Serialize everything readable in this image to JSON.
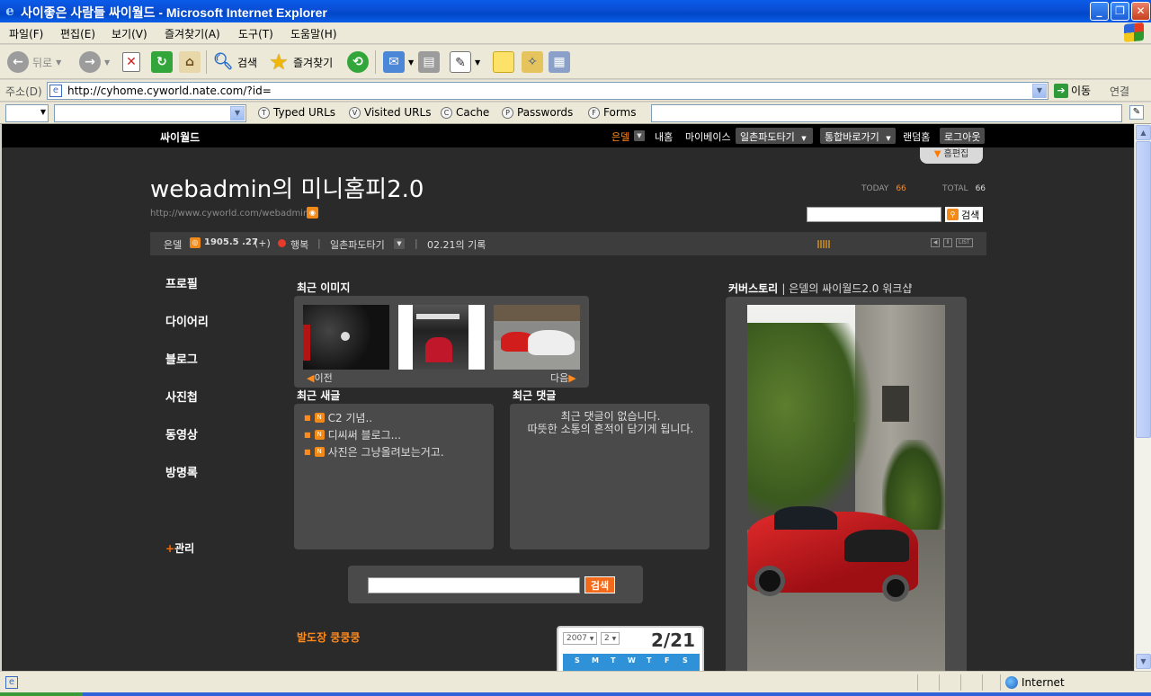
{
  "window": {
    "title": "사이좋은 사람들 싸이월드 - Microsoft Internet Explorer",
    "controls": [
      "_",
      "❐",
      "✕"
    ]
  },
  "menu": [
    "파일(F)",
    "편집(E)",
    "보기(V)",
    "즐겨찾기(A)",
    "도구(T)",
    "도움말(H)"
  ],
  "toolbar": {
    "back": "뒤로",
    "search": "검색",
    "favorites": "즐겨찾기"
  },
  "address": {
    "label": "주소(D)",
    "url": "http://cyhome.cyworld.nate.com/?id=",
    "go": "이동",
    "links": "연결"
  },
  "links_bar": {
    "items": [
      "Typed URLs",
      "Visited URLs",
      "Cache",
      "Passwords",
      "Forms"
    ],
    "icons": [
      "T",
      "V",
      "C",
      "P",
      "F"
    ]
  },
  "statusbar": {
    "zone": "Internet"
  },
  "cy": {
    "logo": "싸이월드",
    "nav": {
      "user": "은델",
      "myhome": "내홈",
      "mybase": "마이베이스",
      "wave": "일촌파도타기",
      "shortcut": "통합바로가기",
      "random": "랜덤홈",
      "logout": "로그아웃"
    },
    "edit_tab": "홈편집",
    "site_title": "webadmin의 미니홈피2.0",
    "site_url": "http://www.cyworld.com/webadmin",
    "counter": {
      "today_label": "TODAY",
      "today_value": "66",
      "total_label": "TOTAL",
      "total_value": "66"
    },
    "search_button": "검색",
    "infobar": {
      "name": "은델",
      "score": "1905.5 .27",
      "plus": "(+)",
      "mood": "행복",
      "wave": "일촌파도타기",
      "record": "02.21의 기록",
      "list": "LIST"
    },
    "side_menu": [
      "프로필",
      "다이어리",
      "블로그",
      "사진첩",
      "동영상",
      "방명록"
    ],
    "admin": "관리",
    "recent_images": {
      "title": "최근 이미지",
      "prev": "이전",
      "next": "다음"
    },
    "recent_posts": {
      "title": "최근 새글",
      "items": [
        "C2 기념..",
        "디씨써 블로그...",
        " 사진은 그냥올려보는거고."
      ]
    },
    "recent_comments": {
      "title": "최근 댓글",
      "empty1": "최근 댓글이 없습니다.",
      "empty2": "따뜻한 소통의 흔적이 담기게 됩니다."
    },
    "bottom_search_button": "검색",
    "guestbook_link": "발도장 쿵쿵쿵",
    "calendar": {
      "year": "2007",
      "month": "2",
      "date": "2/21",
      "weekdays": [
        "S",
        "M",
        "T",
        "W",
        "T",
        "F",
        "S"
      ]
    },
    "cover_story": {
      "title": "커버스토리",
      "subtitle": "은델의 싸이월드2.0 워크샵"
    }
  }
}
